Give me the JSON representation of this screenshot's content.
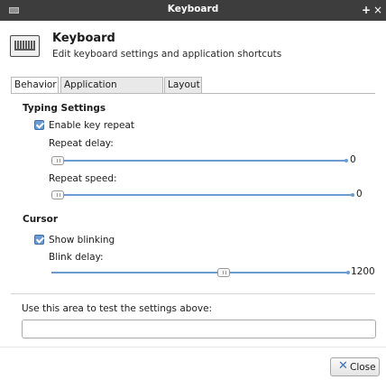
{
  "window": {
    "title": "Keyboard",
    "maximize_glyph": "+",
    "close_glyph": "×"
  },
  "header": {
    "icon": "keyboard-icon",
    "title": "Keyboard",
    "subtitle": "Edit keyboard settings and application shortcuts"
  },
  "tabs": [
    {
      "label": "Behavior",
      "active": true
    },
    {
      "label": "Application Shortcuts",
      "active": false
    },
    {
      "label": "Layout",
      "active": false
    }
  ],
  "typing": {
    "section_title": "Typing Settings",
    "enable_repeat": {
      "label": "Enable key repeat",
      "checked": true
    },
    "repeat_delay": {
      "label": "Repeat delay:",
      "value": "0",
      "fraction": 0.0
    },
    "repeat_speed": {
      "label": "Repeat speed:",
      "value": "0",
      "fraction": 0.0
    }
  },
  "cursor": {
    "section_title": "Cursor",
    "show_blinking": {
      "label": "Show blinking",
      "checked": true
    },
    "blink_delay": {
      "label": "Blink delay:",
      "value": "1200",
      "fraction": 0.57
    }
  },
  "test_area": {
    "label": "Use this area to test the settings above:",
    "value": "",
    "placeholder": ""
  },
  "footer": {
    "close_label": "Close",
    "close_icon": "close-icon"
  },
  "colors": {
    "titlebar": "#3d3d3d",
    "accent": "#6b9bd1"
  }
}
